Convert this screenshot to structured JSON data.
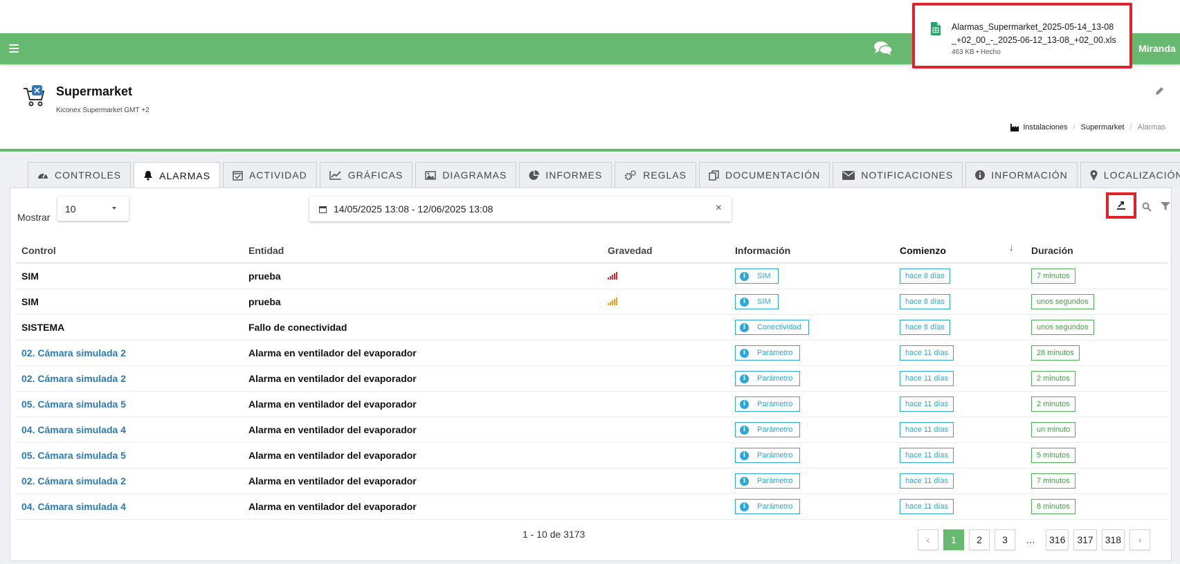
{
  "topbar": {
    "user_name": "Miranda"
  },
  "download": {
    "file_name": "Alarmas_Supermarket_2025-05-14_13-08_+02_00_-_2025-06-12_13-08_+02_00.xls",
    "meta": "463 KB • Hecho"
  },
  "header": {
    "title": "Supermarket",
    "subtitle": "Kiconex Supermarket GMT +2",
    "breadcrumb": [
      "Instalaciones",
      "Supermarket",
      "Alarmas"
    ]
  },
  "tabs": [
    {
      "label": "CONTROLES",
      "icon": "gauge-icon"
    },
    {
      "label": "ALARMAS",
      "icon": "bell-icon",
      "active": true
    },
    {
      "label": "ACTIVIDAD",
      "icon": "calendar-check-icon"
    },
    {
      "label": "GRÁFICAS",
      "icon": "line-chart-icon"
    },
    {
      "label": "DIAGRAMAS",
      "icon": "image-icon"
    },
    {
      "label": "INFORMES",
      "icon": "pie-chart-icon"
    },
    {
      "label": "REGLAS",
      "icon": "gears-icon"
    },
    {
      "label": "DOCUMENTACIÓN",
      "icon": "copy-icon"
    },
    {
      "label": "NOTIFICACIONES",
      "icon": "envelope-icon"
    },
    {
      "label": "INFORMACIÓN",
      "icon": "info-circle-icon"
    },
    {
      "label": "LOCALIZACIÓN",
      "icon": "map-marker-icon"
    }
  ],
  "controls": {
    "show_label": "Mostrar",
    "page_length": "10",
    "date_range": "14/05/2025 13:08 - 12/06/2025 13:08",
    "clear": "×"
  },
  "table": {
    "headers": {
      "control": "Control",
      "entity": "Entidad",
      "severity": "Gravedad",
      "info": "Información",
      "start": "Comienzo",
      "duration": "Duración",
      "sort_indicator": "↓"
    },
    "rows": [
      {
        "control": "SIM",
        "link": false,
        "entity": "prueba",
        "severity_color": "#e0232a",
        "info": "SIM",
        "start": "hace 8 días",
        "duration": "7 minutos"
      },
      {
        "control": "SIM",
        "link": false,
        "entity": "prueba",
        "severity_color": "#f0a020",
        "info": "SIM",
        "start": "hace 8 días",
        "duration": "unos segundos"
      },
      {
        "control": "SISTEMA",
        "link": false,
        "entity": "Fallo de conectividad",
        "severity_color": "",
        "info": "Conectividad",
        "start": "hace 8 días",
        "duration": "unos segundos"
      },
      {
        "control": "02. Cámara simulada 2",
        "link": true,
        "entity": "Alarma en ventilador del evaporador",
        "severity_color": "",
        "info": "Parámetro",
        "start": "hace 11 días",
        "duration": "28 minutos"
      },
      {
        "control": "02. Cámara simulada 2",
        "link": true,
        "entity": "Alarma en ventilador del evaporador",
        "severity_color": "",
        "info": "Parámetro",
        "start": "hace 11 días",
        "duration": "2 minutos"
      },
      {
        "control": "05. Cámara simulada 5",
        "link": true,
        "entity": "Alarma en ventilador del evaporador",
        "severity_color": "",
        "info": "Parámetro",
        "start": "hace 11 días",
        "duration": "2 minutos"
      },
      {
        "control": "04. Cámara simulada 4",
        "link": true,
        "entity": "Alarma en ventilador del evaporador",
        "severity_color": "",
        "info": "Parámetro",
        "start": "hace 11 días",
        "duration": "un minuto"
      },
      {
        "control": "05. Cámara simulada 5",
        "link": true,
        "entity": "Alarma en ventilador del evaporador",
        "severity_color": "",
        "info": "Parámetro",
        "start": "hace 11 días",
        "duration": "5 minutos"
      },
      {
        "control": "02. Cámara simulada 2",
        "link": true,
        "entity": "Alarma en ventilador del evaporador",
        "severity_color": "",
        "info": "Parámetro",
        "start": "hace 11 días",
        "duration": "7 minutos"
      },
      {
        "control": "04. Cámara simulada 4",
        "link": true,
        "entity": "Alarma en ventilador del evaporador",
        "severity_color": "",
        "info": "Parámetro",
        "start": "hace 11 días",
        "duration": "8 minutos"
      }
    ]
  },
  "pagination": {
    "info": "1 - 10 de 3173",
    "prev": "‹",
    "next": "›",
    "pages": [
      "1",
      "2",
      "3",
      "…",
      "316",
      "317",
      "318"
    ],
    "active": "1"
  },
  "colors": {
    "brand_green": "#66b96e",
    "info_blue": "#29a8d8",
    "highlight_red": "#e0232a",
    "link_blue": "#2a7ab8"
  }
}
